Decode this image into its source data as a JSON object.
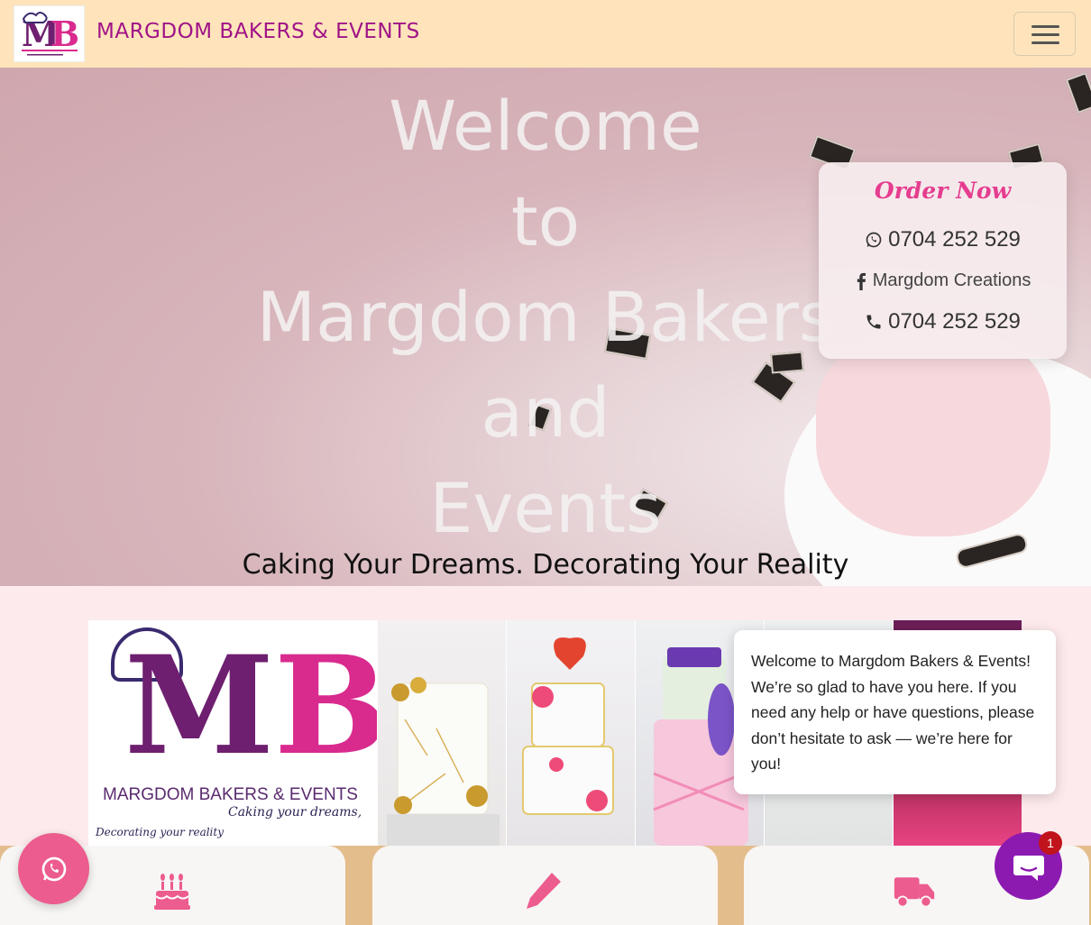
{
  "navbar": {
    "brand": "MARGDOM BAKERS & EVENTS",
    "logo_alt": "MB logo",
    "toggle_icon": "hamburger-menu-icon"
  },
  "hero": {
    "welcome_lines": [
      "Welcome",
      "to",
      "Margdom Bakers",
      "and",
      "Events"
    ],
    "tagline": "Caking Your Dreams. Decorating Your Reality"
  },
  "order_card": {
    "title": "Order Now",
    "whatsapp_number": "0704 252 529",
    "facebook_name": "Margdom Creations",
    "phone_number": "0704 252 529"
  },
  "gallery": {
    "logo_name": "MARGDOM BAKERS & EVENTS",
    "logo_slogan_1": "Caking your dreams,",
    "logo_slogan_2": "Decorating your reality"
  },
  "chat_message": "Welcome to Margdom Bakers & Events! We’re so glad to have you here. If you need any help or have questions, please don’t hesitate to ask — we’re here for you!",
  "chat_badge_count": "1",
  "features": [
    {
      "icon": "birthday-cake-icon"
    },
    {
      "icon": "pencil-icon"
    },
    {
      "icon": "delivery-truck-icon"
    }
  ],
  "colors": {
    "navbar_bg": "#ffe4bb",
    "brand": "#a01488",
    "accent_pink": "#e53d8f",
    "chat_purple": "#8c1ab0"
  }
}
